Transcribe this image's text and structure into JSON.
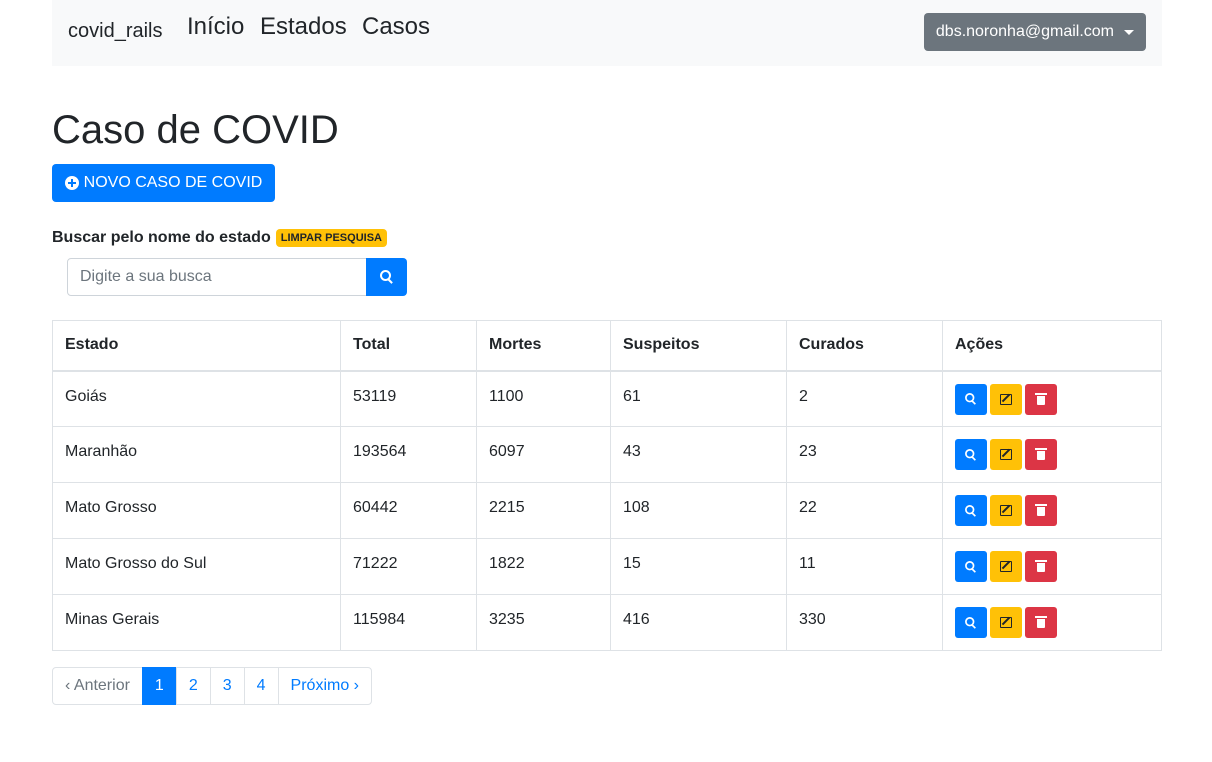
{
  "navbar": {
    "brand": "covid_rails",
    "links": [
      "Início",
      "Estados",
      "Casos"
    ],
    "user_email": "dbs.noronha@gmail.com"
  },
  "page": {
    "title": "Caso de COVID",
    "new_button": "NOVO CASO DE COVID"
  },
  "search": {
    "label": "Buscar pelo nome do estado",
    "clear_badge": "LIMPAR PESQUISA",
    "placeholder": "Digite a sua busca"
  },
  "table": {
    "headers": [
      "Estado",
      "Total",
      "Mortes",
      "Suspeitos",
      "Curados",
      "Ações"
    ],
    "rows": [
      [
        "Goiás",
        "53119",
        "1100",
        "61",
        "2"
      ],
      [
        "Maranhão",
        "193564",
        "6097",
        "43",
        "23"
      ],
      [
        "Mato Grosso",
        "60442",
        "2215",
        "108",
        "22"
      ],
      [
        "Mato Grosso do Sul",
        "71222",
        "1822",
        "15",
        "11"
      ],
      [
        "Minas Gerais",
        "115984",
        "3235",
        "416",
        "330"
      ]
    ]
  },
  "pagination": {
    "prev": "‹ Anterior",
    "pages": [
      "1",
      "2",
      "3",
      "4"
    ],
    "next": "Próximo ›"
  },
  "colors": {
    "primary": "#007bff",
    "warning": "#ffc107",
    "danger": "#dc3545",
    "secondary": "#6c757d"
  }
}
